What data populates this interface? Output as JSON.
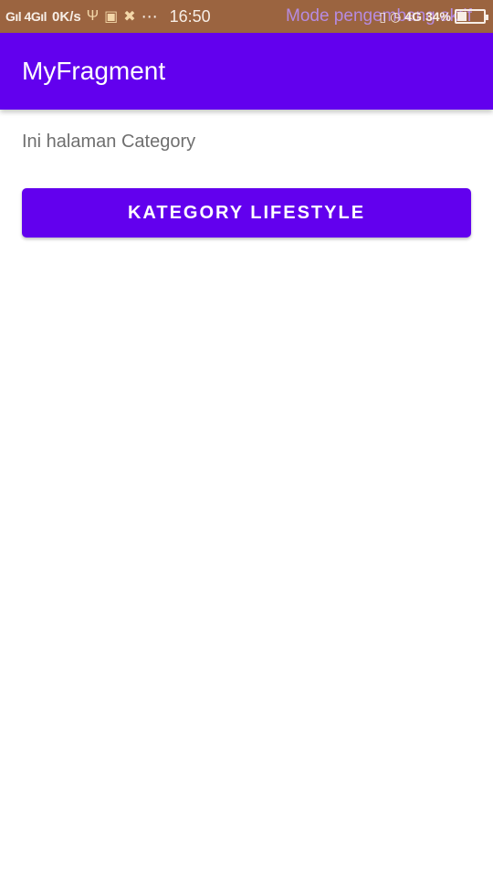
{
  "status_bar": {
    "signal_text": "Gıl 4Gıl",
    "speed": "0K/s",
    "time": "16:50",
    "notification_text": "Mode pengembang aktif",
    "network": "4G",
    "battery": "34%"
  },
  "app_bar": {
    "title": "MyFragment"
  },
  "main": {
    "info_text": "Ini halaman Category",
    "button_label": "KATEGORY LIFESTYLE"
  },
  "colors": {
    "primary": "#6200ee",
    "status_bar": "#9b6440"
  }
}
